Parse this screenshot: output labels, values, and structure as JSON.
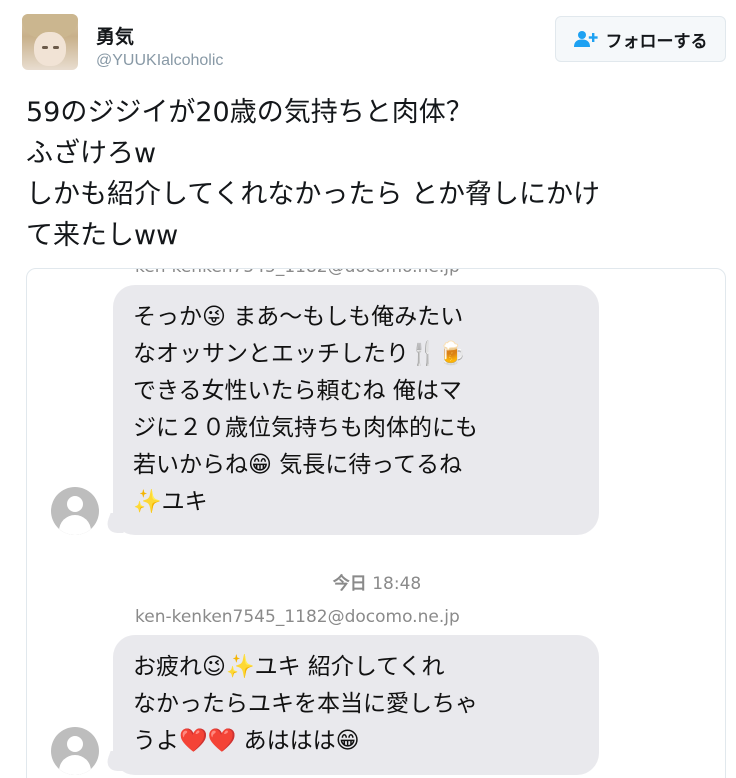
{
  "user": {
    "display_name": "勇気",
    "handle": "@YUUKIalcoholic",
    "avatar_icon": "profile-photo"
  },
  "follow_button": {
    "label": "フォローする",
    "icon": "follow-person-icon",
    "icon_color": "#1da1f2"
  },
  "tweet": {
    "lines": [
      "59のジジイが20歳の気持ちと肉体？",
      "ふざけろw",
      "しかも紹介してくれなかったら とか脅しにかけ",
      "て来たしww"
    ]
  },
  "screenshot": {
    "partial_email": "ken-kenken7545_1182@docomo.ne.jp",
    "message1_lines": [
      "そっか😜  まあ〜もしも俺みたい",
      "なオッサンとエッチしたり🍴🍺",
      "できる女性いたら頼むね  俺はマ",
      "ジに２０歳位気持ちも肉体的にも",
      "若いからね😁  気長に待ってるね",
      "✨ユキ"
    ],
    "timestamp_day": "今日",
    "timestamp_time": "18:48",
    "sender_email": "ken-kenken7545_1182@docomo.ne.jp",
    "message2_lines": [
      "お疲れ😉✨ユキ  紹介してくれ",
      "なかったらユキを本当に愛しちゃ",
      "うよ❤️❤️  あははは😁"
    ],
    "bubble_color": "#e9e9ed"
  }
}
